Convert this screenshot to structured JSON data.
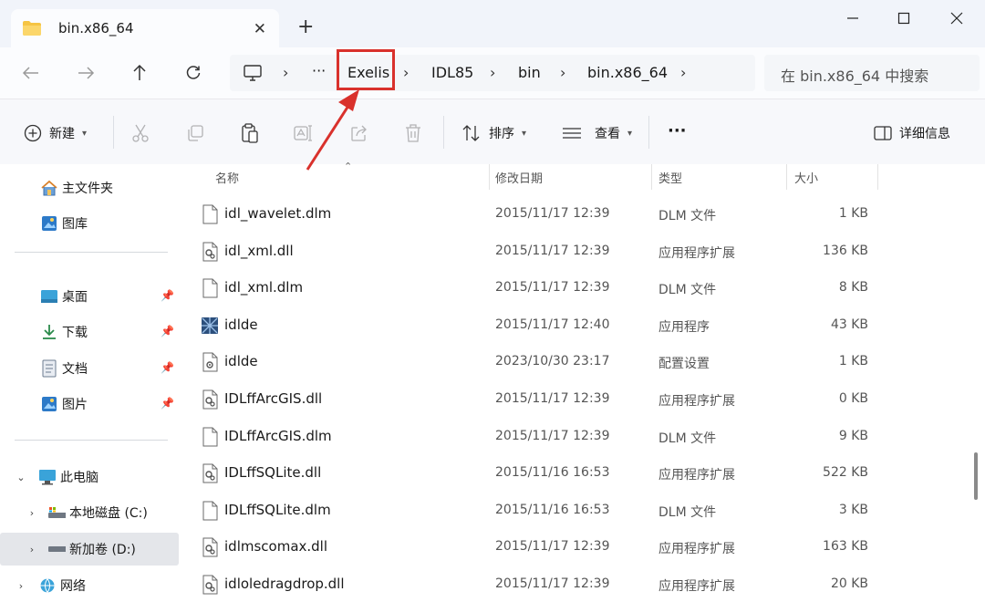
{
  "tab": {
    "title": "bin.x86_64",
    "close_glyph": "✕",
    "new_tab_glyph": "+"
  },
  "window_controls": {
    "minimize": "minimize-icon",
    "maximize": "maximize-icon",
    "close": "close-icon"
  },
  "address_bar": {
    "overflow": "···",
    "separator": "›",
    "crumbs": [
      "Exelis",
      "IDL85",
      "bin",
      "bin.x86_64"
    ],
    "highlighted_crumb": "Exelis"
  },
  "search": {
    "placeholder": "在 bin.x86_64 中搜索"
  },
  "toolbar": {
    "new_label": "新建",
    "sort_label": "排序",
    "view_label": "查看",
    "more_label": "···",
    "details_label": "详细信息"
  },
  "sidebar": {
    "home": "主文件夹",
    "gallery": "图库",
    "desktop": "桌面",
    "downloads": "下载",
    "documents": "文档",
    "pictures": "图片",
    "this_pc": "此电脑",
    "drive_c": "本地磁盘 (C:)",
    "drive_d": "新加卷 (D:)",
    "network": "网络"
  },
  "columns": {
    "name": "名称",
    "modified": "修改日期",
    "type": "类型",
    "size": "大小"
  },
  "files": [
    {
      "name": "idl_wavelet.dlm",
      "date": "2015/11/17 12:39",
      "type": "DLM 文件",
      "size": "1 KB",
      "icon": "file-icon"
    },
    {
      "name": "idl_xml.dll",
      "date": "2015/11/17 12:39",
      "type": "应用程序扩展",
      "size": "136 KB",
      "icon": "dll-icon"
    },
    {
      "name": "idl_xml.dlm",
      "date": "2015/11/17 12:39",
      "type": "DLM 文件",
      "size": "8 KB",
      "icon": "file-icon"
    },
    {
      "name": "idlde",
      "date": "2015/11/17 12:40",
      "type": "应用程序",
      "size": "43 KB",
      "icon": "app-icon"
    },
    {
      "name": "idlde",
      "date": "2023/10/30 23:17",
      "type": "配置设置",
      "size": "1 KB",
      "icon": "config-icon"
    },
    {
      "name": "IDLffArcGIS.dll",
      "date": "2015/11/17 12:39",
      "type": "应用程序扩展",
      "size": "0 KB",
      "icon": "dll-icon"
    },
    {
      "name": "IDLffArcGIS.dlm",
      "date": "2015/11/17 12:39",
      "type": "DLM 文件",
      "size": "9 KB",
      "icon": "file-icon"
    },
    {
      "name": "IDLffSQLite.dll",
      "date": "2015/11/16 16:53",
      "type": "应用程序扩展",
      "size": "522 KB",
      "icon": "dll-icon"
    },
    {
      "name": "IDLffSQLite.dlm",
      "date": "2015/11/16 16:53",
      "type": "DLM 文件",
      "size": "3 KB",
      "icon": "file-icon"
    },
    {
      "name": "idlmscomax.dll",
      "date": "2015/11/17 12:39",
      "type": "应用程序扩展",
      "size": "163 KB",
      "icon": "dll-icon"
    },
    {
      "name": "idloledragdrop.dll",
      "date": "2015/11/17 12:39",
      "type": "应用程序扩展",
      "size": "20 KB",
      "icon": "dll-icon"
    }
  ],
  "colors": {
    "accent": "#0067c0",
    "highlight": "#d9312c",
    "folder": "#f5c443"
  }
}
